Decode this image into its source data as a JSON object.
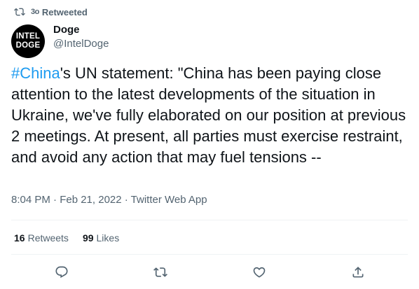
{
  "retweet_context": {
    "icon": "retweet-icon",
    "avatar_label": "3o",
    "label": "Retweeted"
  },
  "author": {
    "avatar_lines": [
      "INTEL",
      "DOGE"
    ],
    "name": "Doge",
    "handle": "@IntelDoge"
  },
  "tweet": {
    "hashtag": "#China",
    "text": "'s UN statement: \"China has been paying close attention to the latest developments of the situation in Ukraine, we've fully elaborated on our position at previous 2 meetings. At present, all parties must exercise restraint, and avoid any action that may fuel tensions --",
    "timestamp": "8:04 PM · Feb 21, 2022 · Twitter Web App"
  },
  "stats": {
    "retweets_count": "16",
    "retweets_label": "Retweets",
    "likes_count": "99",
    "likes_label": "Likes"
  },
  "actions": {
    "icons": [
      "reply-icon",
      "retweet-icon",
      "like-icon",
      "share-icon"
    ]
  },
  "colors": {
    "accent": "#1d9bf0",
    "text": "#0f1419",
    "secondary": "#536471",
    "divider": "#eff3f4"
  }
}
